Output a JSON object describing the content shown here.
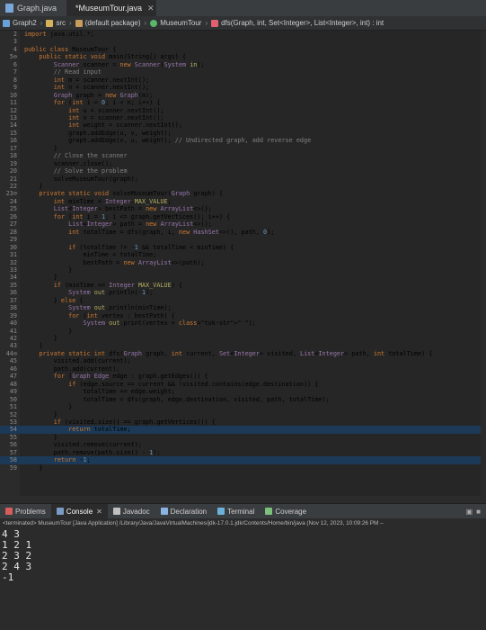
{
  "tabs": [
    {
      "label": "Graph.java"
    },
    {
      "label": "*MuseumTour.java",
      "close": "✕"
    }
  ],
  "breadcrumb": [
    {
      "label": "Graph2",
      "icon": "project-icon",
      "color": "#6aa0d8"
    },
    {
      "label": "src",
      "icon": "folder-icon",
      "color": "#d6b25b"
    },
    {
      "label": "(default package)",
      "icon": "package-icon",
      "color": "#c89c5a"
    },
    {
      "label": "MuseumTour",
      "icon": "class-icon",
      "color": "#59b66b"
    },
    {
      "label": "dfs(Graph, int, Set<Integer>, List<Integer>, int) : int",
      "icon": "method-icon",
      "color": "#e06070"
    }
  ],
  "code": [
    {
      "n": "2",
      "t": "import java.util.*;"
    },
    {
      "n": "3",
      "t": ""
    },
    {
      "n": "4",
      "t": "public class MuseumTour {"
    },
    {
      "n": "5⊖",
      "t": "    public static void main(String[] args) {"
    },
    {
      "n": "6",
      "t": "        Scanner scanner = new Scanner(System.in);"
    },
    {
      "n": "7",
      "t": "        // Read input"
    },
    {
      "n": "8",
      "t": "        int m = scanner.nextInt();"
    },
    {
      "n": "9",
      "t": "        int n = scanner.nextInt();"
    },
    {
      "n": "10",
      "t": "        Graph graph = new Graph(m);"
    },
    {
      "n": "11",
      "t": "        for (int i = 0; i < n; i++) {"
    },
    {
      "n": "12",
      "t": "            int u = scanner.nextInt();"
    },
    {
      "n": "13",
      "t": "            int v = scanner.nextInt();"
    },
    {
      "n": "14",
      "t": "            int weight = scanner.nextInt();"
    },
    {
      "n": "15",
      "t": "            graph.addEdge(u, v, weight);"
    },
    {
      "n": "16",
      "t": "            graph.addEdge(v, u, weight); // Undirected graph, add reverse edge"
    },
    {
      "n": "17",
      "t": "        }"
    },
    {
      "n": "18",
      "t": "        // Close the scanner"
    },
    {
      "n": "19",
      "t": "        scanner.close();"
    },
    {
      "n": "20",
      "t": "        // Solve the problem"
    },
    {
      "n": "21",
      "t": "        solveMuseumTour(graph);"
    },
    {
      "n": "22",
      "t": "    }"
    },
    {
      "n": "23⊖",
      "t": "    private static void solveMuseumTour(Graph graph) {"
    },
    {
      "n": "24",
      "t": "        int minTime = Integer.MAX_VALUE;"
    },
    {
      "n": "25",
      "t": "        List<Integer> bestPath = new ArrayList<>();"
    },
    {
      "n": "26",
      "t": "        for (int i = 1; i <= graph.getVertices(); i++) {"
    },
    {
      "n": "27",
      "t": "            List<Integer> path = new ArrayList<>();"
    },
    {
      "n": "28",
      "t": "            int totalTime = dfs(graph, i, new HashSet<>(), path, 0);"
    },
    {
      "n": "29",
      "t": ""
    },
    {
      "n": "30",
      "t": "            if (totalTime != -1 && totalTime < minTime) {"
    },
    {
      "n": "31",
      "t": "                minTime = totalTime;"
    },
    {
      "n": "32",
      "t": "                bestPath = new ArrayList<>(path);"
    },
    {
      "n": "33",
      "t": "            }"
    },
    {
      "n": "34",
      "t": "        }"
    },
    {
      "n": "35",
      "t": "        if (minTime == Integer.MAX_VALUE) {"
    },
    {
      "n": "36",
      "t": "            System.out.println(-1);"
    },
    {
      "n": "37",
      "t": "        } else {"
    },
    {
      "n": "38",
      "t": "            System.out.println(minTime);"
    },
    {
      "n": "39",
      "t": "            for (int vertex : bestPath) {"
    },
    {
      "n": "40",
      "t": "                System.out.print(vertex + \" \");"
    },
    {
      "n": "41",
      "t": "            }"
    },
    {
      "n": "42",
      "t": "        }"
    },
    {
      "n": "43",
      "t": "    }"
    },
    {
      "n": "44⊖",
      "t": "    private static int dfs(Graph graph, int current, Set<Integer> visited, List<Integer> path, int totalTime) {"
    },
    {
      "n": "45",
      "t": "        visited.add(current);"
    },
    {
      "n": "46",
      "t": "        path.add(current);"
    },
    {
      "n": "47",
      "t": "        for (Graph.Edge edge : graph.getEdges()) {"
    },
    {
      "n": "48",
      "t": "            if (edge.source == current && !visited.contains(edge.destination)) {"
    },
    {
      "n": "49",
      "t": "                totalTime += edge.weight;"
    },
    {
      "n": "50",
      "t": "                totalTime = dfs(graph, edge.destination, visited, path, totalTime);"
    },
    {
      "n": "51",
      "t": "            }"
    },
    {
      "n": "52",
      "t": "        }"
    },
    {
      "n": "53",
      "t": "        if (visited.size() == graph.getVertices()) {"
    },
    {
      "n": "54",
      "t": "            return totalTime;",
      "hl": true
    },
    {
      "n": "55",
      "t": "        }"
    },
    {
      "n": "56",
      "t": "        visited.remove(current);"
    },
    {
      "n": "57",
      "t": "        path.remove(path.size() - 1);"
    },
    {
      "n": "58",
      "t": "        return -1;",
      "hl": true
    },
    {
      "n": "59",
      "t": "    }"
    }
  ],
  "console_tabs": [
    {
      "label": "Problems",
      "color": "#d75c5c"
    },
    {
      "label": "Console",
      "color": "#7a9cc4",
      "active": true,
      "close": "✕"
    },
    {
      "label": "Javadoc",
      "color": "#c0c0c0"
    },
    {
      "label": "Declaration",
      "color": "#8cb4e2"
    },
    {
      "label": "Terminal",
      "color": "#6cb1d9"
    },
    {
      "label": "Coverage",
      "color": "#7cc07c"
    }
  ],
  "console_status": "<terminated> MuseumTour [Java Application] /Library/Java/JavaVirtualMachines/jdk-17.0.1.jdk/Contents/Home/bin/java  (Nov 12, 2023, 10:09:26 PM –",
  "console_output": [
    "4 3",
    "1 2 1",
    "2 3 2",
    "2 4 3",
    "-1"
  ]
}
